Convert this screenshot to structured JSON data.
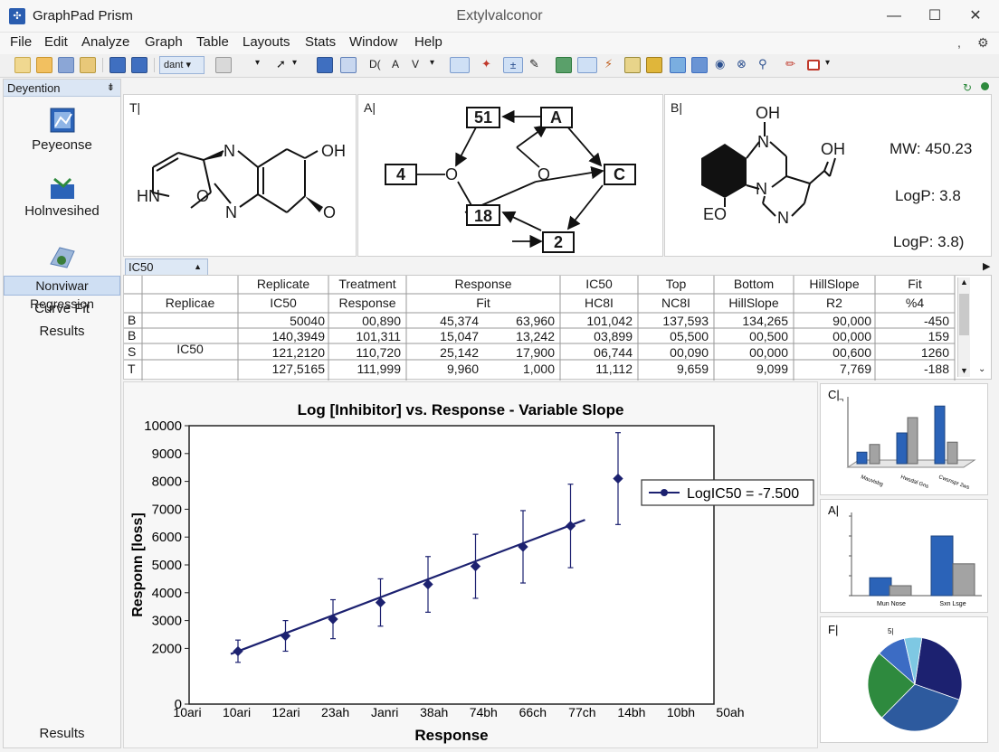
{
  "window": {
    "app_name": "GraphPad Prism",
    "doc_title": "Extylvalconor",
    "min": "—",
    "max": "☐",
    "close": "✕"
  },
  "menu": [
    "File",
    "Edit",
    "Analyze",
    "Graph",
    "Table",
    "Layouts",
    "Stats",
    "Window",
    "Help"
  ],
  "toolbar": {
    "dropdown_label": "dant"
  },
  "navigator": {
    "header": "Deyention",
    "items": [
      "Peyeonse",
      "Holnvesihed"
    ],
    "selected": "Nonviwar Regression",
    "sub_items": [
      "Curve Fit",
      "Results"
    ],
    "footer": "Results"
  },
  "panels": {
    "t": {
      "letter": "T|",
      "atoms": {
        "n1": "N",
        "oh": "OH",
        "hn": "HN",
        "o": "O",
        "n2": "N",
        "o2": "O"
      }
    },
    "a": {
      "letter": "A|",
      "nodes": {
        "n51": "51",
        "na": "A",
        "n4": "4",
        "nc": "C",
        "n18": "18",
        "n2": "2",
        "o1": "O",
        "o2": "O"
      }
    },
    "b": {
      "letter": "B|",
      "atoms": {
        "oh1": "OH",
        "n1": "N",
        "oh2": "OH",
        "n2": "N",
        "eo": "EO",
        "n3": "N"
      },
      "props": {
        "mw": "MW: 450.23",
        "logp1": "LogP: 3.8",
        "logp2": "LogP: 3.8)"
      }
    }
  },
  "table": {
    "tab_label": "IC50",
    "headers_top": [
      "Replicate",
      "Treatment",
      "Response",
      "IC50",
      "Top",
      "Bottom",
      "HillSlope",
      "Fit"
    ],
    "headers_sub": [
      "IC50",
      "Response",
      "Fit",
      "HC8I",
      "NC8I",
      "HillSlope",
      "R2",
      "%4"
    ],
    "replicate_col_label": "Replicae",
    "group_label": "IC50",
    "row_letters": [
      "B",
      "B",
      "S",
      "T"
    ],
    "rows": [
      [
        "50040",
        "00,890",
        "45,374",
        "63,960",
        "101,042",
        "137,593",
        "134,265",
        "90,000",
        "-450"
      ],
      [
        "140,3949",
        "101,311",
        "15,047",
        "13,242",
        "03,899",
        "05,500",
        "00,500",
        "00,000",
        "159"
      ],
      [
        "121,2120",
        "110,720",
        "25,142",
        "17,900",
        "06,744",
        "00,090",
        "00,000",
        "00,600",
        "1260"
      ],
      [
        "127,5165",
        "111,999",
        "9,960",
        "1,000",
        "11,112",
        "9,659",
        "9,099",
        "7,769",
        "-188"
      ]
    ]
  },
  "chart_data": [
    {
      "type": "line",
      "title": "Log [Inhibitor] vs. Response - Variable Slope",
      "xlabel": "Response",
      "ylabel": "Responn [loss]",
      "x_tick_labels": [
        "10ari",
        "10ari",
        "12ari",
        "23ah",
        "Janri",
        "38ah",
        "74bh",
        "66ch",
        "77ch",
        "14bh",
        "10bh",
        "50ah"
      ],
      "y_tick_labels": [
        "0",
        "2000",
        "3000",
        "4000",
        "5000",
        "6000",
        "7000",
        "8000",
        "9000",
        "10000"
      ],
      "ylim": [
        0,
        10000
      ],
      "legend": "LogIC50 = -7.500",
      "legend_position": "right",
      "series": [
        {
          "points": [
            {
              "y": 1900,
              "err": 400
            },
            {
              "y": 2450,
              "err": 550
            },
            {
              "y": 3050,
              "err": 700
            },
            {
              "y": 3650,
              "err": 850
            },
            {
              "y": 4300,
              "err": 1000
            },
            {
              "y": 4950,
              "err": 1150
            },
            {
              "y": 5650,
              "err": 1300
            },
            {
              "y": 6400,
              "err": 1500
            },
            {
              "y": 8100,
              "err": 1650
            }
          ],
          "fit": {
            "y_start": 1800,
            "y_end": 6620
          }
        }
      ],
      "color": "#1c2170"
    },
    {
      "type": "bar",
      "panel": "C|",
      "series": [
        {
          "color": "#2b63b8",
          "values": [
            15,
            40,
            75
          ]
        },
        {
          "color": "#a3a3a3",
          "values": [
            25,
            60,
            28
          ]
        }
      ],
      "category_labels": [
        "Mauvisbg",
        "Hwsdal Gns",
        "Cwsnspr 2ws"
      ]
    },
    {
      "type": "bar",
      "panel": "A|",
      "series": [
        {
          "color": "#2b63b8",
          "values": [
            45,
            150
          ]
        },
        {
          "color": "#a3a3a3",
          "values": [
            25,
            80
          ]
        }
      ],
      "categories": [
        "Mun Nose",
        "Sxn Lsge"
      ]
    },
    {
      "type": "pie",
      "panel": "F|",
      "label": "5|",
      "slices": [
        {
          "color": "#1c2170",
          "value": 28
        },
        {
          "color": "#2d5a9e",
          "value": 32
        },
        {
          "color": "#2e8a3e",
          "value": 24
        },
        {
          "color": "#3c6cc4",
          "value": 10
        },
        {
          "color": "#7ec8e3",
          "value": 6
        }
      ]
    }
  ]
}
